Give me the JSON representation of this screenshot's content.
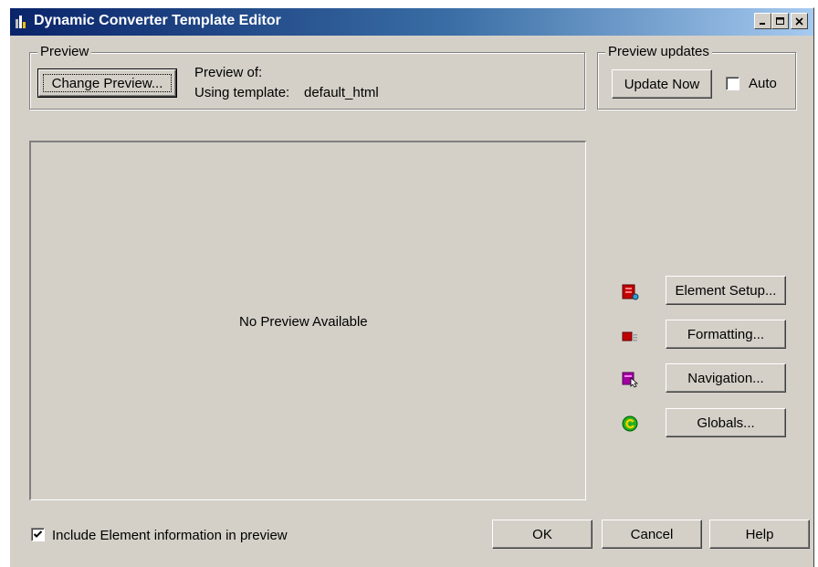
{
  "window": {
    "title": "Dynamic Converter Template Editor"
  },
  "preview_group": {
    "label": "Preview",
    "change_button": "Change Preview...",
    "preview_of_label": "Preview of:",
    "template_label": "Using template:",
    "template_value": "default_html"
  },
  "updates_group": {
    "label": "Preview updates",
    "update_button": "Update Now",
    "auto_label": "Auto",
    "auto_checked": false
  },
  "preview_pane": {
    "message": "No Preview Available"
  },
  "side_buttons": [
    {
      "label": "Element Setup...",
      "icon": "element-setup-icon"
    },
    {
      "label": "Formatting...",
      "icon": "formatting-icon"
    },
    {
      "label": "Navigation...",
      "icon": "navigation-icon"
    },
    {
      "label": "Globals...",
      "icon": "globals-icon"
    }
  ],
  "footer": {
    "include_info_label": "Include Element information in preview",
    "include_info_checked": true,
    "ok_button": "OK",
    "cancel_button": "Cancel",
    "help_button": "Help"
  },
  "colors": {
    "dialog_face": "#d4d0c8",
    "titlebar_start": "#0a246a",
    "titlebar_end": "#a6caf0"
  }
}
